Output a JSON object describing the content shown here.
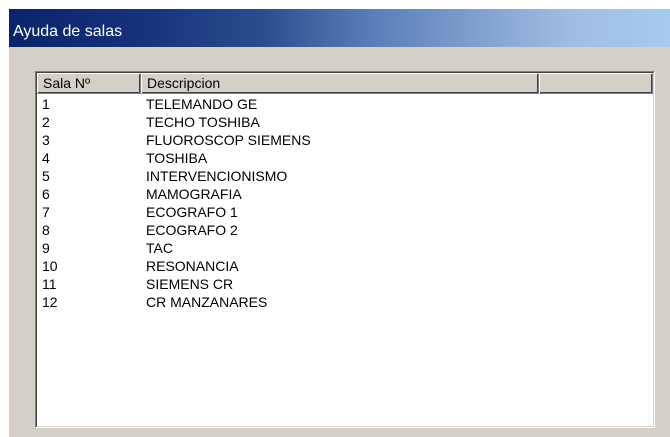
{
  "window": {
    "title": "Ayuda de salas"
  },
  "list": {
    "columns": [
      "Sala Nº",
      "Descripcion",
      ""
    ],
    "rows": [
      {
        "num": "1",
        "desc": "TELEMANDO GE"
      },
      {
        "num": "2",
        "desc": "TECHO TOSHIBA"
      },
      {
        "num": "3",
        "desc": "FLUOROSCOP SIEMENS"
      },
      {
        "num": "4",
        "desc": "TOSHIBA"
      },
      {
        "num": "5",
        "desc": "INTERVENCIONISMO"
      },
      {
        "num": "6",
        "desc": "MAMOGRAFIA"
      },
      {
        "num": "7",
        "desc": "ECOGRAFO 1"
      },
      {
        "num": "8",
        "desc": "ECOGRAFO 2"
      },
      {
        "num": "9",
        "desc": "TAC"
      },
      {
        "num": "10",
        "desc": "RESONANCIA"
      },
      {
        "num": "11",
        "desc": "SIEMENS CR"
      },
      {
        "num": "12",
        "desc": "CR MANZANARES"
      }
    ]
  },
  "colors": {
    "title_start": "#0a246a",
    "title_end": "#a6caf0",
    "face": "#d4d0c8"
  }
}
